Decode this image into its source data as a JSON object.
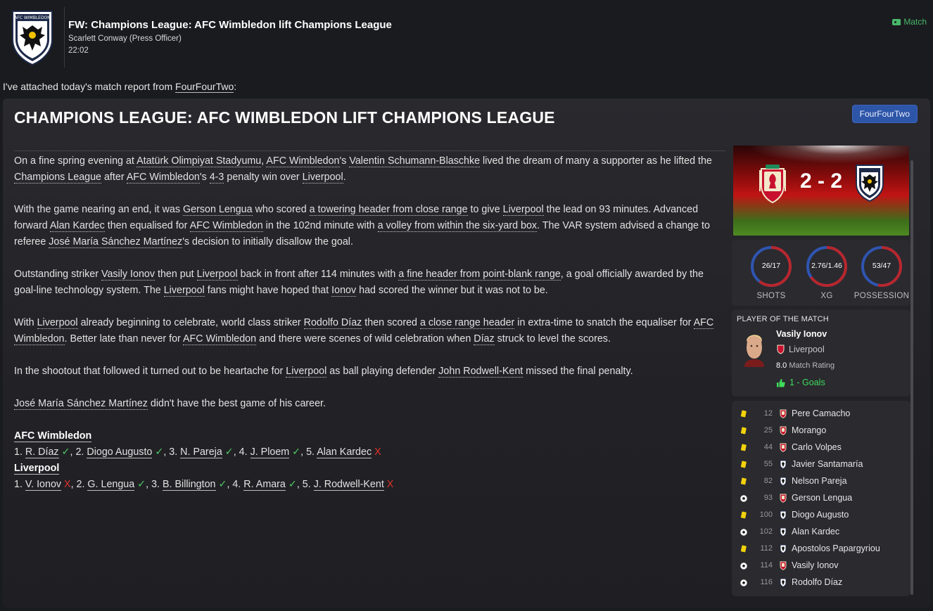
{
  "message": {
    "club_name": "AFC WIMBLEDON",
    "title": "FW: Champions League: AFC Wimbledon lift Champions League",
    "sender": "Scarlett Conway  (Press Officer)",
    "time": "22:02",
    "match_link": "Match",
    "intro_prefix": "I've attached today's match report from ",
    "intro_source": "FourFourTwo",
    "intro_suffix": ":"
  },
  "article": {
    "headline": "CHAMPIONS LEAGUE: AFC WIMBLEDON LIFT CHAMPIONS LEAGUE",
    "source_button": "FourFourTwo",
    "p1": [
      {
        "t": "On a fine spring evening at "
      },
      {
        "t": "Atatürk Olimpiyat Stadyumu",
        "l": 1
      },
      {
        "t": ", "
      },
      {
        "t": "AFC Wimbledon",
        "l": 1
      },
      {
        "t": "'s "
      },
      {
        "t": "Valentin Schumann-Blaschke",
        "l": 1
      },
      {
        "t": " lived the dream of many a supporter as he lifted the "
      },
      {
        "t": "Champions League",
        "l": 1
      },
      {
        "t": " after "
      },
      {
        "t": "AFC Wimbledon",
        "l": 1
      },
      {
        "t": "'s "
      },
      {
        "t": "4-3",
        "l": 1
      },
      {
        "t": " penalty win over "
      },
      {
        "t": "Liverpool",
        "l": 1
      },
      {
        "t": "."
      }
    ],
    "p2": [
      {
        "t": "With the game nearing an end, it was "
      },
      {
        "t": "Gerson Lengua",
        "l": 1
      },
      {
        "t": " who scored "
      },
      {
        "t": "a towering header from close range",
        "l": 1
      },
      {
        "t": " to give "
      },
      {
        "t": "Liverpool",
        "l": 1
      },
      {
        "t": " the lead on 93 minutes. Advanced forward "
      },
      {
        "t": "Alan Kardec",
        "l": 1
      },
      {
        "t": " then equalised for "
      },
      {
        "t": "AFC Wimbledon",
        "l": 1
      },
      {
        "t": " in the 102nd minute with "
      },
      {
        "t": "a volley from within the six-yard box",
        "l": 1
      },
      {
        "t": ". The VAR system advised a change to referee "
      },
      {
        "t": "José María Sánchez Martínez",
        "l": 1
      },
      {
        "t": "'s decision to initially disallow the goal."
      }
    ],
    "p3": [
      {
        "t": "Outstanding striker "
      },
      {
        "t": "Vasily Ionov",
        "l": 1
      },
      {
        "t": " then put "
      },
      {
        "t": "Liverpool",
        "l": 1
      },
      {
        "t": " back in front after 114 minutes with "
      },
      {
        "t": "a fine header from point-blank range",
        "l": 1
      },
      {
        "t": ", a goal officially awarded by the goal-line technology system. The "
      },
      {
        "t": "Liverpool",
        "l": 1
      },
      {
        "t": " fans might have hoped that "
      },
      {
        "t": "Ionov",
        "l": 1
      },
      {
        "t": " had scored the winner but it was not to be."
      }
    ],
    "p4": [
      {
        "t": "With "
      },
      {
        "t": "Liverpool",
        "l": 1
      },
      {
        "t": " already beginning to celebrate, world class striker "
      },
      {
        "t": "Rodolfo Díaz",
        "l": 1
      },
      {
        "t": " then scored "
      },
      {
        "t": "a close range header",
        "l": 1
      },
      {
        "t": " in extra-time to snatch the equaliser for "
      },
      {
        "t": "AFC Wimbledon",
        "l": 1
      },
      {
        "t": ". Better late than never for "
      },
      {
        "t": "AFC Wimbledon",
        "l": 1
      },
      {
        "t": " and there were scenes of wild celebration when "
      },
      {
        "t": "Díaz",
        "l": 1
      },
      {
        "t": " struck to level the scores."
      }
    ],
    "p5": [
      {
        "t": "In the shootout that followed it turned out to be heartache for "
      },
      {
        "t": "Liverpool",
        "l": 1
      },
      {
        "t": " as ball playing defender "
      },
      {
        "t": "John Rodwell-Kent",
        "l": 1
      },
      {
        "t": " missed the final penalty."
      }
    ],
    "p6": [
      {
        "t": "José María Sánchez Martínez",
        "l": 1
      },
      {
        "t": " didn't have the best game of his career."
      }
    ],
    "shootout": [
      {
        "team": "AFC Wimbledon",
        "kicks": [
          {
            "n": "1.",
            "name": "R. Díaz",
            "scored": true
          },
          {
            "n": "2.",
            "name": "Diogo Augusto",
            "scored": true
          },
          {
            "n": "3.",
            "name": "N. Pareja",
            "scored": true
          },
          {
            "n": "4.",
            "name": "J. Ploem",
            "scored": true
          },
          {
            "n": "5.",
            "name": "Alan Kardec",
            "scored": false
          }
        ]
      },
      {
        "team": "Liverpool",
        "kicks": [
          {
            "n": "1.",
            "name": "V. Ionov",
            "scored": false
          },
          {
            "n": "2.",
            "name": "G. Lengua",
            "scored": true
          },
          {
            "n": "3.",
            "name": "B. Billington",
            "scored": true
          },
          {
            "n": "4.",
            "name": "R. Amara",
            "scored": true
          },
          {
            "n": "5.",
            "name": "J. Rodwell-Kent",
            "scored": false
          }
        ]
      }
    ],
    "tick_glyph": "✓",
    "miss_glyph": "X"
  },
  "score": {
    "home_crest": "liverpool-crest",
    "away_crest": "afc-wimbledon-crest",
    "score_text": "2 - 2"
  },
  "stats": [
    {
      "label": "SHOTS",
      "value": "26/17",
      "home": 26,
      "away": 17
    },
    {
      "label": "XG",
      "value": "2.76/1.46",
      "home": 2.76,
      "away": 1.46
    },
    {
      "label": "POSSESSION",
      "value": "53/47",
      "home": 53,
      "away": 47
    }
  ],
  "colors": {
    "home": "#b8262c",
    "away": "#2f55b0",
    "goal_green": "#3fdb5a",
    "card_yellow": "#f2d20a",
    "link_green": "#47b86a"
  },
  "potm": {
    "title": "PLAYER OF THE MATCH",
    "name": "Vasily Ionov",
    "club": "Liverpool",
    "rating_value": "8.0",
    "rating_label": "Match Rating",
    "goals": "1 - Goals"
  },
  "events": [
    {
      "type": "yellow-card",
      "minute": "12",
      "club": "liverpool",
      "player": "Pere Camacho"
    },
    {
      "type": "yellow-card",
      "minute": "25",
      "club": "liverpool",
      "player": "Morango"
    },
    {
      "type": "yellow-card",
      "minute": "44",
      "club": "liverpool",
      "player": "Carlo Volpes"
    },
    {
      "type": "yellow-card",
      "minute": "55",
      "club": "afc-wimbledon",
      "player": "Javier Santamaría"
    },
    {
      "type": "yellow-card",
      "minute": "82",
      "club": "afc-wimbledon",
      "player": "Nelson Pareja"
    },
    {
      "type": "goal",
      "minute": "93",
      "club": "liverpool",
      "player": "Gerson Lengua"
    },
    {
      "type": "yellow-card",
      "minute": "100",
      "club": "afc-wimbledon",
      "player": "Diogo Augusto"
    },
    {
      "type": "goal",
      "minute": "102",
      "club": "afc-wimbledon",
      "player": "Alan Kardec"
    },
    {
      "type": "yellow-card",
      "minute": "112",
      "club": "afc-wimbledon",
      "player": "Apostolos Papargyriou"
    },
    {
      "type": "goal",
      "minute": "114",
      "club": "liverpool",
      "player": "Vasily Ionov"
    },
    {
      "type": "goal",
      "minute": "116",
      "club": "afc-wimbledon",
      "player": "Rodolfo Díaz"
    }
  ]
}
